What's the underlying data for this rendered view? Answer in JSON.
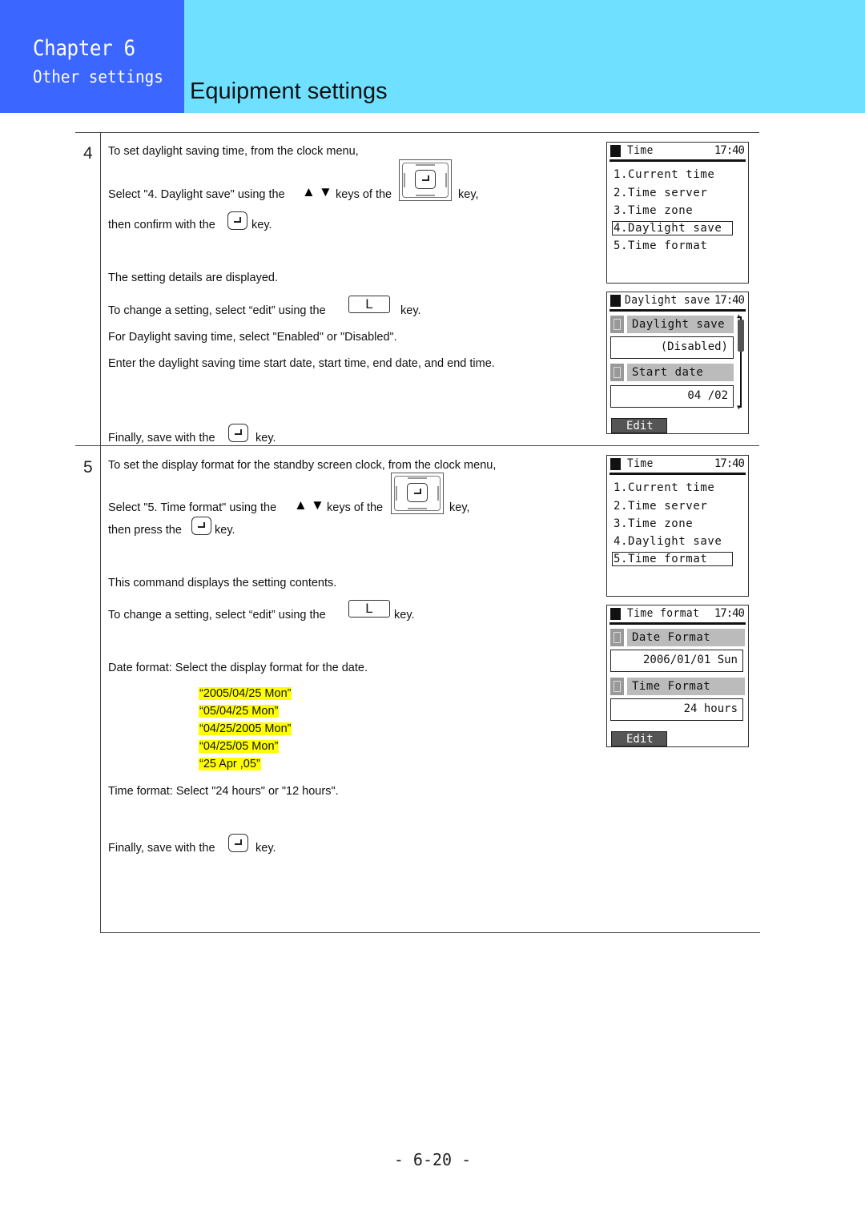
{
  "header": {
    "chapter": "Chapter 6",
    "chapter_subtitle": "Other settings",
    "page_title": "Equipment settings",
    "colors": {
      "chapter_bg": "#3b66ff",
      "title_bg": "#6fe0ff"
    }
  },
  "step4": {
    "number": "4",
    "line1": "To set daylight saving time, from the clock menu,",
    "line2_pre": "Select \"4. Daylight save\" using the",
    "line2_mid": "keys of the",
    "line2_post": "key,",
    "line3_pre": "then confirm with the",
    "line3_post": "key.",
    "line4": "The setting details are displayed.",
    "line5_pre": "To change a setting, select “edit” using the",
    "line5_post": "key.",
    "line6": "For Daylight saving time, select \"Enabled\" or \"Disabled\".",
    "line7": "Enter the daylight saving time start date, start time, end date, and end time.",
    "line8_pre": "Finally, save with the",
    "line8_post": "key.",
    "l_key": "L",
    "up_icon": "▲",
    "down_icon": "▼"
  },
  "step5": {
    "number": "5",
    "line1": "To set the display format for the standby screen clock, from the clock menu,",
    "line2_pre": "Select \"5. Time format\" using the",
    "line2_mid": "keys of the",
    "line2_post": "key,",
    "line3_pre": "then press the",
    "line3_post": "key.",
    "line4": "This command displays the setting contents.",
    "line5_pre": "To change a setting, select “edit” using the",
    "line5_post": "key.",
    "line6": "Date format:  Select the display format for the date.",
    "date_formats": [
      "“2005/04/25 Mon”",
      "“05/04/25 Mon”",
      "“04/25/2005 Mon”",
      "“04/25/05 Mon”",
      "“25 Apr ,05”"
    ],
    "line7": "Time format:  Select \"24 hours\" or \"12 hours\".",
    "line8_pre": "Finally, save with the",
    "line8_post": "key.",
    "l_key": "L",
    "up_icon": "▲",
    "down_icon": "▼",
    "highlight_color": "#ffff00"
  },
  "lcd1": {
    "title": "Time",
    "clock": "17:40",
    "items": [
      "1.Current time",
      "2.Time server",
      "3.Time zone",
      "4.Daylight save",
      "5.Time format"
    ],
    "selected_index": 3
  },
  "lcd2": {
    "title": "Daylight save",
    "clock": "17:40",
    "field1_label": "Daylight save",
    "field1_value": "(Disabled)",
    "field2_label": "Start date",
    "field2_value": "04 /02",
    "edit": "Edit"
  },
  "lcd3": {
    "title": "Time",
    "clock": "17:40",
    "items": [
      "1.Current time",
      "2.Time server",
      "3.Time zone",
      "4.Daylight save",
      "5.Time format"
    ],
    "selected_index": 4
  },
  "lcd4": {
    "title": "Time format",
    "clock": "17:40",
    "field1_label": "Date Format",
    "field1_value": "2006/01/01 Sun",
    "field2_label": "Time Format",
    "field2_value": "24 hours",
    "edit": "Edit"
  },
  "footer": {
    "page_number": "- 6-20 -"
  }
}
